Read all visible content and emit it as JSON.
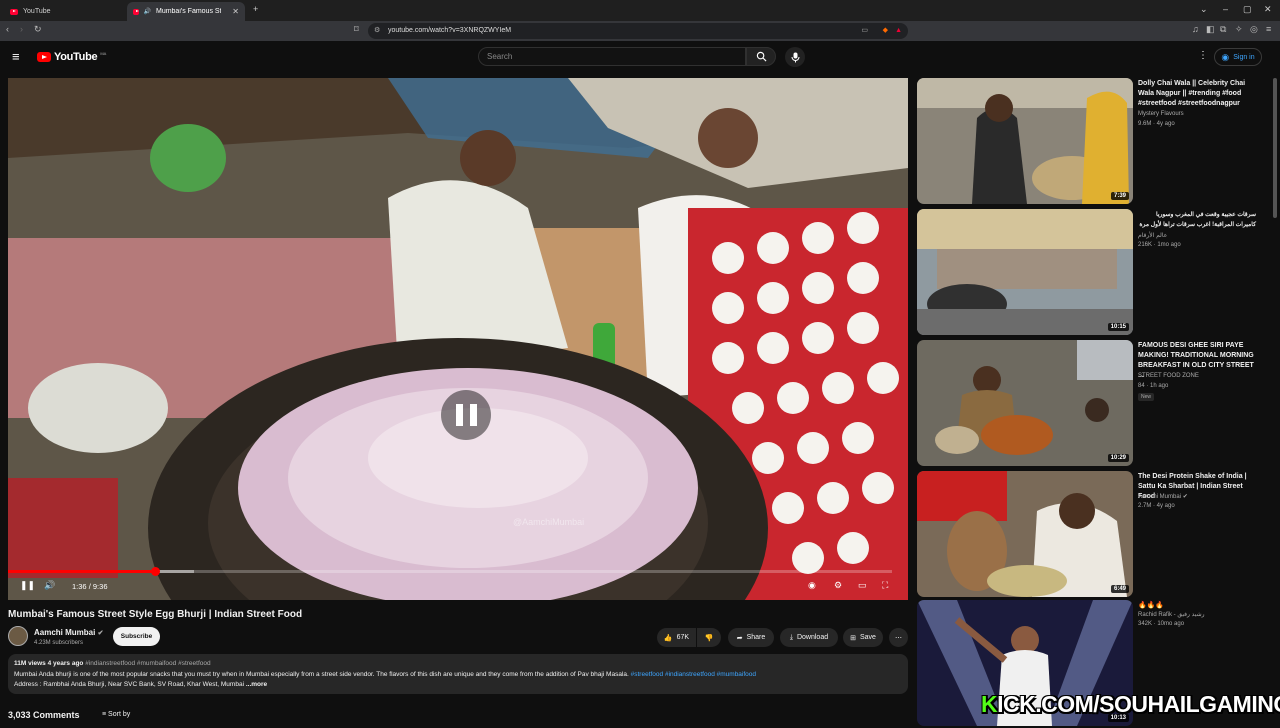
{
  "browser": {
    "tabs": [
      {
        "label": "YouTube"
      },
      {
        "label": "Mumbai's Famous Street Style"
      }
    ],
    "url": "youtube.com/watch?v=3XNRQZWYIeM"
  },
  "header": {
    "logo_text": "YouTube",
    "logo_country": "MA",
    "search_placeholder": "Search",
    "signin_label": "Sign in"
  },
  "player": {
    "time_current": "1:36",
    "time_separator": "/",
    "time_total": "9:36",
    "progress_played": 0.1667,
    "progress_buffered": 0.21,
    "video_watermark": "@AamchiMumbai",
    "state": "paused"
  },
  "video": {
    "title": "Mumbai's Famous Street Style Egg Bhurji | Indian Street Food",
    "channel": "Aamchi Mumbai",
    "subscribers": "4.23M subscribers",
    "subscribe_label": "Subscribe",
    "likes": "67K",
    "share_label": "Share",
    "download_label": "Download",
    "save_label": "Save",
    "views": "11M views",
    "age": "4 years ago",
    "hashtags": "#indianstreetfood #mumbaifood #streetfood",
    "description_line1": "Mumbai Anda bhurji is one of the most popular snacks that you must try when in Mumbai especially from a street side vendor. The flavors of this dish are unique and they come from the addition of Pav bhaji Masala.",
    "description_tags": "#streetfood #indianstreetfood #mumbaifood",
    "description_line2": "Address : Rambhai Anda Bhurji, Near SVC Bank, SV Road, Khar West, Mumbai ",
    "more_label": "...more",
    "comments_count": "3,033 Comments",
    "sort_label": "Sort by"
  },
  "recommendations": [
    {
      "title": "Dolly Chai Wala || Celebrity Chai Wala Nagpur || #trending #food #streetfood #streetfoodnagpur",
      "channel": "Mystery Flavours",
      "meta": "9.6M · 4y ago",
      "duration": "7:39"
    },
    {
      "title": "سرقات عجيبة وقعت في المغرب وسوريا كاميرات المراقبة! اغرب سرقات تراها لأول مرة",
      "channel": "عالم الأرقام",
      "meta": "216K · 1mo ago",
      "duration": "10:15"
    },
    {
      "title": "FAMOUS DESI GHEE SIRI PAYE MAKING! TRADITIONAL MORNING BREAKFAST IN OLD CITY STREET ...",
      "channel": "STREET FOOD ZONE",
      "meta": "84 · 1h ago",
      "badge": "New",
      "duration": "10:29"
    },
    {
      "title": "The Desi Protein Shake of India | Sattu Ka Sharbat | Indian Street Food",
      "channel": "Aamchi Mumbai",
      "meta": "2.7M · 4y ago",
      "duration": "6:49"
    },
    {
      "title": "🔥🔥🔥",
      "channel": "Rachid Rafik - رشيد رفيق",
      "meta": "342K · 10mo ago",
      "duration": "10:13"
    }
  ],
  "overlay_text": {
    "prefix": "K",
    "rest": "ICK.COM/SOUHAILGAMING"
  }
}
